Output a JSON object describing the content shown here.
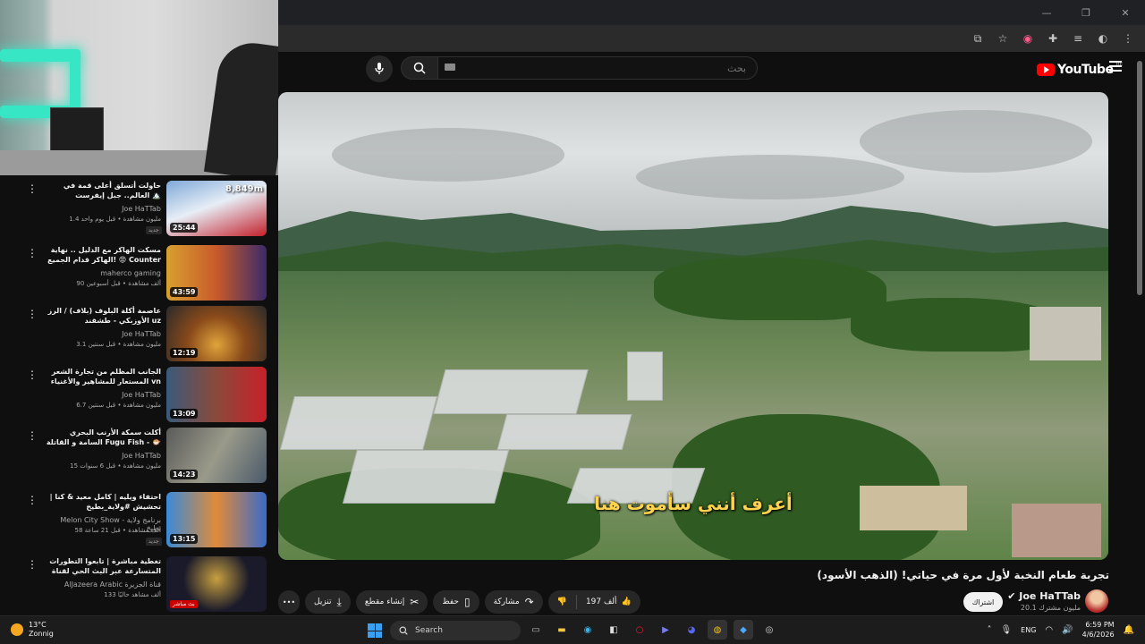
{
  "browser": {
    "window_controls": [
      "—",
      "❐",
      "✕"
    ]
  },
  "header": {
    "search_placeholder": "بحث",
    "logo_text": "YouTube",
    "region": "BE"
  },
  "video": {
    "subtitle": "أعرف أنني سأموت هنا",
    "title": "تجربة طعام النخبة لأول مرة في حياتي! (الذهب الأسود)",
    "channel": "Joe HaTTab",
    "subscribers": "20.1 مليون مشترك",
    "subscribe_label": "اشتراك",
    "likes": "197 ألف",
    "share_label": "مشاركة",
    "save_label": "حفظ",
    "clip_label": "إنشاء مقطع",
    "download_label": "تنزيل",
    "more_label": "•••"
  },
  "recommendations": [
    {
      "title": "حاولت أتسلق أعلى قمة في العالم.. جبل إيفرست 🏔️",
      "channel": "Joe HaTTab",
      "meta": "1.4 مليون مشاهدة • قبل يوم واحد",
      "duration": "25:44",
      "overlay": "8,849m",
      "tag": "جديد"
    },
    {
      "title": "مسكت الهاكر مع الدليل .. نهاية الهاكر قدام الجميع! 😡 Counter Strike 2",
      "channel": "maherco gaming",
      "meta": "90 ألف مشاهدة • قبل أسبوعين",
      "duration": "43:59",
      "overlay": "",
      "tag": ""
    },
    {
      "title": "عاصمة أكلة البلوف (بلاف) / الرز الأوزبكي - طشقند uz",
      "channel": "Joe HaTTab",
      "meta": "3.1 مليون مشاهدة • قبل سنتين",
      "duration": "12:19",
      "overlay": "",
      "tag": ""
    },
    {
      "title": "الجانب المظلم من تجارة الشعر المستعار للمشاهير والأغنياء vn",
      "channel": "Joe HaTTab",
      "meta": "6.7 مليون مشاهدة • قبل سنتين",
      "duration": "13:09",
      "overlay": "",
      "tag": ""
    },
    {
      "title": "أكلت سمكة الأرنب البحري السامة و القاتلة Fugu Fish - 🐡",
      "channel": "Joe HaTTab",
      "meta": "15 مليون مشاهدة • قبل 6 سنوات",
      "duration": "14:23",
      "overlay": "",
      "tag": ""
    },
    {
      "title": "احتفاء ويليه | كامل معيد & كنا | تحشيش #ولاية_بطيخ",
      "channel": "Melon City Show - برنامج ولاية بطيخ",
      "meta": "58 ألف مشاهدة • قبل 21 ساعة",
      "duration": "13:15",
      "overlay": "",
      "tag": "جديد"
    },
    {
      "title": "تغطية مباشرة | تابعوا التطورات المتسارعة عبر البث الحي لقناة الجزيرة",
      "channel": "AlJazeera Arabic قناة الجزيرة",
      "meta": "133 ألف مشاهد حاليًا",
      "duration": "",
      "overlay": "",
      "tag": "",
      "live": "بث مباشر"
    }
  ],
  "taskbar": {
    "temperature": "13°C",
    "weather": "Zonnig",
    "search": "Search",
    "language": "ENG",
    "time": "6:59 PM",
    "date": "4/6/2026"
  },
  "colors": {
    "accent": "#ff0000",
    "subtitle": "#ffd34d",
    "neon": "#37e6c4"
  }
}
